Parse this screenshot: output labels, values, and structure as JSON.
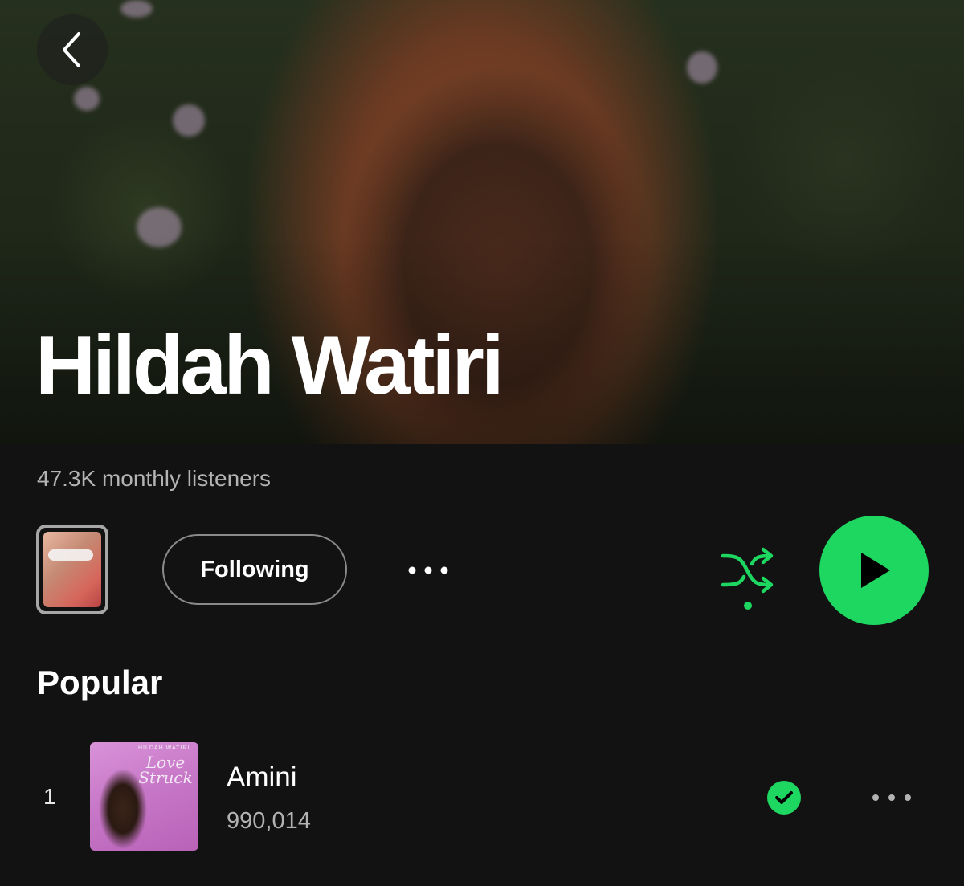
{
  "header": {
    "artist_name": "Hildah Watiri",
    "back_icon": "chevron-left-icon"
  },
  "stats": {
    "monthly_listeners": "47.3K monthly listeners"
  },
  "controls": {
    "follow_label": "Following",
    "more_icon": "more-horizontal-icon",
    "shuffle_icon": "shuffle-icon",
    "play_icon": "play-icon",
    "accent_color": "#1ed760"
  },
  "popular": {
    "title": "Popular",
    "tracks": [
      {
        "rank": "1",
        "title": "Amini",
        "plays": "990,014",
        "cover_text": "Love Struck",
        "cover_artist": "HILDAH WATIRI",
        "saved": true
      }
    ]
  }
}
